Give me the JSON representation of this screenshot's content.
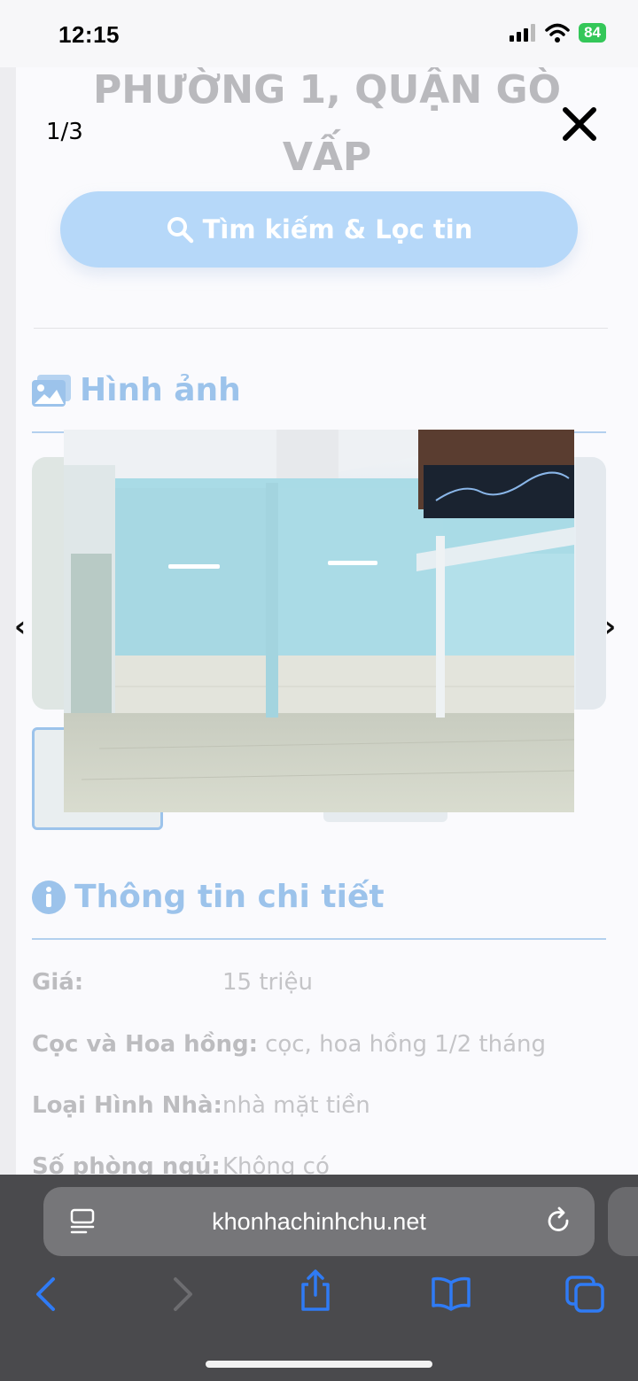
{
  "status_bar": {
    "time": "12:15",
    "battery": "84"
  },
  "page": {
    "hero_title_line1": "PHƯỜNG 1, QUẬN GÒ",
    "hero_title_line2": "VẤP",
    "search_button_label": "Tìm kiếm & Lọc tin",
    "images_section_title": "Hình ảnh",
    "details_section_title": "Thông tin chi tiết",
    "details": [
      {
        "label": "Giá:",
        "value": "15 triệu"
      },
      {
        "label": "Cọc và Hoa hồng:",
        "value": "cọc, hoa hồng 1/2 tháng"
      },
      {
        "label": "Loại Hình Nhà:",
        "value": "nhà mặt tiền"
      },
      {
        "label": "Số phòng ngủ:",
        "value": "Không có"
      }
    ]
  },
  "lightbox": {
    "counter": "1/3",
    "prev_arrow": "‹",
    "next_arrow": "›"
  },
  "browser": {
    "url": "khonhachinhchu.net"
  },
  "colors": {
    "accent_light_blue": "#b6d8f9",
    "section_blue": "#9cc3eb",
    "battery_green": "#34c759",
    "toolbar_gray": "#4a4a4d",
    "toolbar_icon_blue": "#2f7bf5"
  }
}
